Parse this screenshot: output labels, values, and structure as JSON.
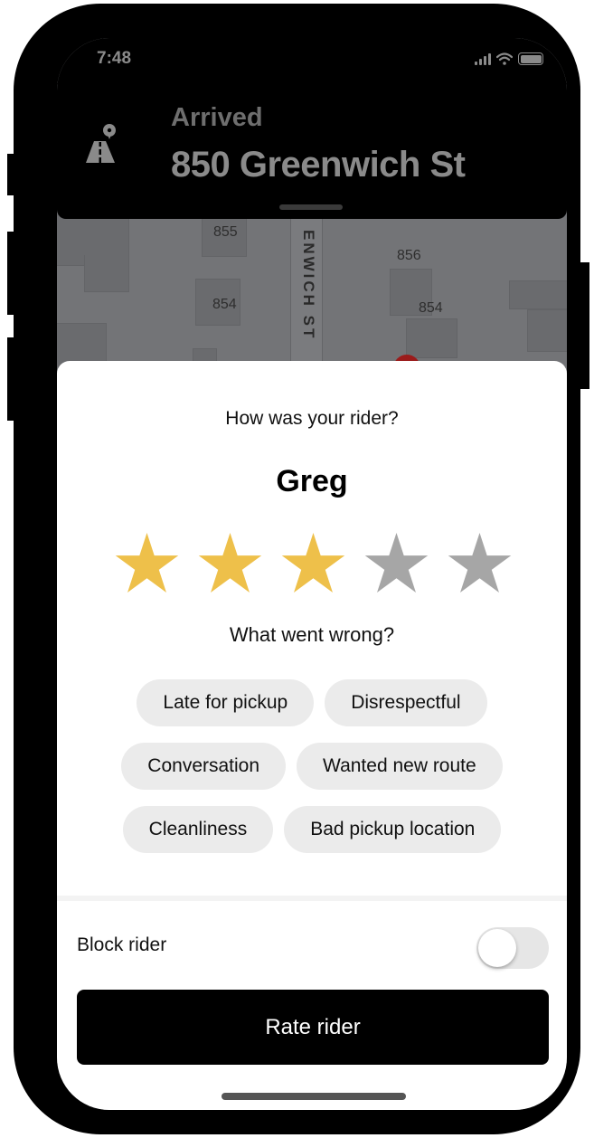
{
  "status_bar": {
    "time": "7:48",
    "icons": [
      "signal-icon",
      "wifi-icon",
      "battery-icon"
    ]
  },
  "header": {
    "status": "Arrived",
    "address": "850 Greenwich St",
    "icon": "road-pin-icon"
  },
  "map": {
    "street_label": "ENWICH ST",
    "address_numbers": [
      "855",
      "854",
      "856",
      "854"
    ]
  },
  "rating": {
    "question": "How was your rider?",
    "rider_name": "Greg",
    "stars_selected": 3,
    "stars_total": 5,
    "star_active_color": "#EEC04A",
    "star_inactive_color": "#A6A6A6"
  },
  "feedback": {
    "question": "What went wrong?",
    "options": [
      [
        "Late for pickup",
        "Disrespectful"
      ],
      [
        "Conversation",
        "Wanted new route"
      ],
      [
        "Cleanliness",
        "Bad pickup location"
      ]
    ]
  },
  "block_rider": {
    "label": "Block rider",
    "enabled": false
  },
  "primary_action": {
    "label": "Rate rider"
  }
}
